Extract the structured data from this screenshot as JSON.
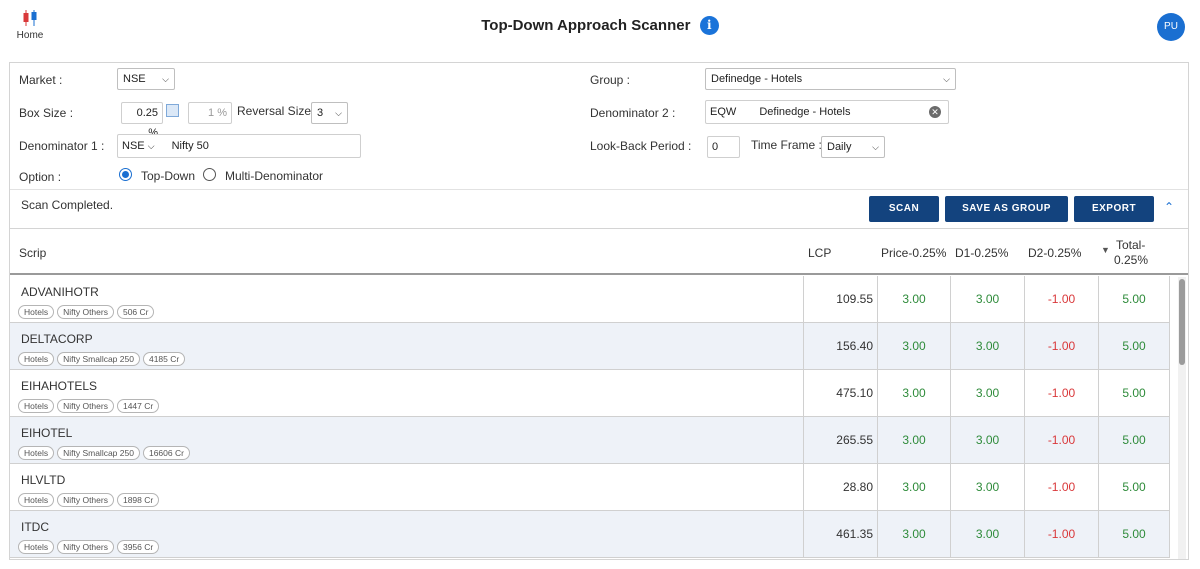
{
  "header": {
    "home_label": "Home",
    "title": "Top-Down Approach Scanner",
    "info_glyph": "i",
    "avatar": "PU"
  },
  "form": {
    "market_label": "Market :",
    "market_value": "NSE",
    "box_size_label": "Box Size :",
    "box_size_value": "0.25 %",
    "box_size_2_value": "1 %",
    "reversal_label": "Reversal Size :",
    "reversal_value": "3",
    "denom1_label": "Denominator 1 :",
    "denom1_exchange": "NSE",
    "denom1_value": "Nifty 50",
    "option_label": "Option :",
    "option_topdown": "Top-Down",
    "option_multi": "Multi-Denominator",
    "group_label": "Group :",
    "group_value": "Definedge - Hotels",
    "denom2_label": "Denominator 2 :",
    "denom2_prefix": "EQW",
    "denom2_value": "Definedge - Hotels",
    "lookback_label": "Look-Back Period :",
    "lookback_value": "0",
    "timeframe_label": "Time Frame :",
    "timeframe_value": "Daily"
  },
  "status": {
    "text": "Scan Completed.",
    "scan_btn": "SCAN",
    "save_btn": "SAVE AS GROUP",
    "export_btn": "EXPORT"
  },
  "table": {
    "headers": {
      "scrip": "Scrip",
      "lcp": "LCP",
      "price": "Price-0.25%",
      "d1": "D1-0.25%",
      "d2": "D2-0.25%",
      "total_1": "Total-",
      "total_2": "0.25%"
    },
    "rows": [
      {
        "scrip": "ADVANIHOTR",
        "tags": [
          "Hotels",
          "Nifty Others",
          "506 Cr"
        ],
        "lcp": "109.55",
        "price": "3.00",
        "d1": "3.00",
        "d2": "-1.00",
        "total": "5.00"
      },
      {
        "scrip": "DELTACORP",
        "tags": [
          "Hotels",
          "Nifty Smallcap 250",
          "4185 Cr"
        ],
        "lcp": "156.40",
        "price": "3.00",
        "d1": "3.00",
        "d2": "-1.00",
        "total": "5.00"
      },
      {
        "scrip": "EIHAHOTELS",
        "tags": [
          "Hotels",
          "Nifty Others",
          "1447 Cr"
        ],
        "lcp": "475.10",
        "price": "3.00",
        "d1": "3.00",
        "d2": "-1.00",
        "total": "5.00"
      },
      {
        "scrip": "EIHOTEL",
        "tags": [
          "Hotels",
          "Nifty Smallcap 250",
          "16606 Cr"
        ],
        "lcp": "265.55",
        "price": "3.00",
        "d1": "3.00",
        "d2": "-1.00",
        "total": "5.00"
      },
      {
        "scrip": "HLVLTD",
        "tags": [
          "Hotels",
          "Nifty Others",
          "1898 Cr"
        ],
        "lcp": "28.80",
        "price": "3.00",
        "d1": "3.00",
        "d2": "-1.00",
        "total": "5.00"
      },
      {
        "scrip": "ITDC",
        "tags": [
          "Hotels",
          "Nifty Others",
          "3956 Cr"
        ],
        "lcp": "461.35",
        "price": "3.00",
        "d1": "3.00",
        "d2": "-1.00",
        "total": "5.00"
      }
    ]
  },
  "colors": {
    "positive": "#2e8b3a",
    "negative": "#d9383a",
    "button": "#13437e",
    "accent": "#1a6fd1"
  }
}
